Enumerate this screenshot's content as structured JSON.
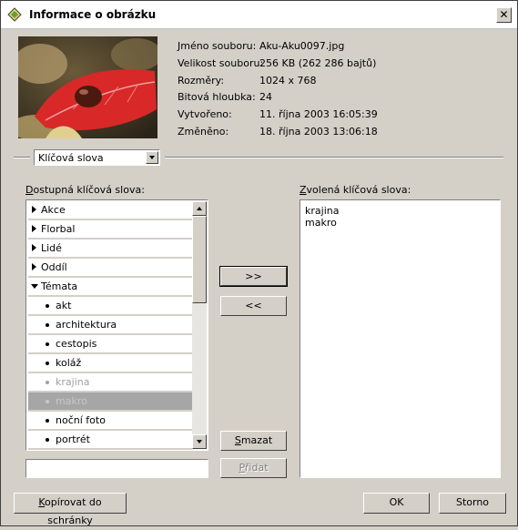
{
  "title": "Informace o obrázku",
  "close_label": "✕",
  "info": {
    "rows": [
      {
        "label": "Jméno souboru:",
        "value": "Aku-Aku0097.jpg"
      },
      {
        "label": "Velikost souboru:",
        "value": "256 KB (262 286 bajtů)"
      },
      {
        "label": "Rozměry:",
        "value": "1024 x 768"
      },
      {
        "label": "Bitová hloubka:",
        "value": "24"
      },
      {
        "label": "Vytvořeno:",
        "value": "11. října 2003 16:05:39"
      },
      {
        "label": "Změněno:",
        "value": "18. října 2003 13:06:18"
      }
    ]
  },
  "combo": {
    "selected": "Klíčová slova"
  },
  "available": {
    "label_mnemonic": "D",
    "label_rest": "ostupná klíčová slova:",
    "items": [
      {
        "text": "Akce",
        "kind": "category",
        "state": "collapsed"
      },
      {
        "text": "Florbal",
        "kind": "category",
        "state": "collapsed"
      },
      {
        "text": "Lidé",
        "kind": "category",
        "state": "collapsed"
      },
      {
        "text": "Oddíl",
        "kind": "category",
        "state": "collapsed"
      },
      {
        "text": "Témata",
        "kind": "category",
        "state": "open"
      },
      {
        "text": "akt",
        "kind": "item",
        "state": "normal"
      },
      {
        "text": "architektura",
        "kind": "item",
        "state": "normal"
      },
      {
        "text": "cestopis",
        "kind": "item",
        "state": "normal"
      },
      {
        "text": "koláž",
        "kind": "item",
        "state": "normal"
      },
      {
        "text": "krajina",
        "kind": "item",
        "state": "dim"
      },
      {
        "text": "makro",
        "kind": "item",
        "state": "selected"
      },
      {
        "text": "noční foto",
        "kind": "item",
        "state": "normal"
      },
      {
        "text": "portrét",
        "kind": "item",
        "state": "normal"
      }
    ]
  },
  "chosen": {
    "label_mnemonic": "Z",
    "label_rest": "volená klíčová slova:",
    "items": [
      "krajina",
      "makro"
    ]
  },
  "buttons": {
    "add_arrow": ">>",
    "remove_arrow": "<<",
    "delete_mnemonic": "S",
    "delete_rest": "mazat",
    "add_mnemonic": "P",
    "add_rest": "řidat",
    "copy_mnemonic": "K",
    "copy_rest": "opírovat do schránky",
    "ok": "OK",
    "cancel": "Storno"
  },
  "new_keyword": {
    "value": ""
  }
}
